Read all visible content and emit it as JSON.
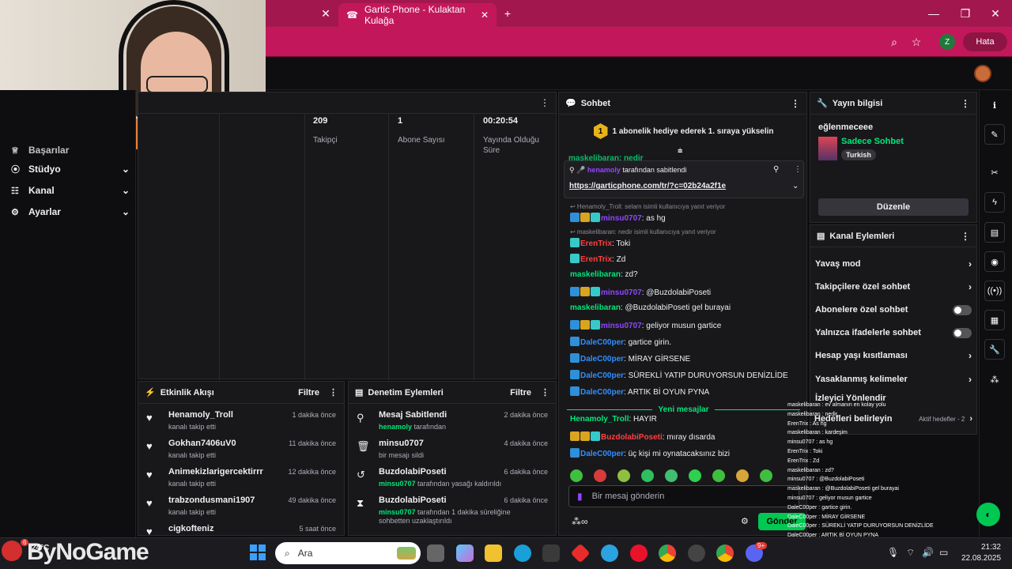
{
  "browser": {
    "tab_title": "Gartic Phone - Kulaktan Kulağa",
    "profile_initial": "Z",
    "status_button": "Hata"
  },
  "sidebar": {
    "items": [
      {
        "label": "Başarılar",
        "icon": "trophy-icon"
      },
      {
        "label": "Stüdyo",
        "icon": "camera-icon"
      },
      {
        "label": "Kanal",
        "icon": "people-icon"
      },
      {
        "label": "Ayarlar",
        "icon": "gear-icon"
      }
    ]
  },
  "stats": [
    {
      "value": "209",
      "label": "Takipçi"
    },
    {
      "value": "1",
      "label": "Abone Sayısı"
    },
    {
      "value": "00:20:54",
      "label": "Yayında Olduğu Süre"
    }
  ],
  "activity": {
    "title": "Etkinlik Akışı",
    "filter": "Filtre",
    "items": [
      {
        "name": "Henamoly_Troll",
        "sub": "kanalı takip etti",
        "time": "1 dakika önce"
      },
      {
        "name": "Gokhan7406uV0",
        "sub": "kanalı takip etti",
        "time": "11 dakika önce"
      },
      {
        "name": "Animekizlarigercektirrr",
        "sub": "kanalı takip etti",
        "time": "12 dakika önce"
      },
      {
        "name": "trabzondusmani1907",
        "sub": "kanalı takip etti",
        "time": "49 dakika önce"
      },
      {
        "name": "cigkofteniz",
        "sub": "",
        "time": "5 saat önce"
      }
    ]
  },
  "moderation": {
    "title": "Denetim Eylemleri",
    "filter": "Filtre",
    "items": [
      {
        "title": "Mesaj Sabitlendi",
        "user": "henamoly",
        "rest": " tarafından",
        "time": "2 dakika önce",
        "icon": "pin-icon"
      },
      {
        "title": "minsu0707",
        "user": "",
        "rest": "bir mesajı sildi",
        "time": "4 dakika önce",
        "icon": "trash-icon"
      },
      {
        "title": "BuzdolabiPoseti",
        "user": "minsu0707",
        "rest": " tarafından yasağı kaldırıldı",
        "time": "6 dakika önce",
        "icon": "undo-icon"
      },
      {
        "title": "BuzdolabiPoseti",
        "user": "minsu0707",
        "rest": " tarafından 1 dakika süreliğine sohbetten uzaklaştırıldı",
        "time": "6 dakika önce",
        "icon": "hourglass-icon"
      }
    ]
  },
  "chat": {
    "title": "Sohbet",
    "gift_banner": "1 abonelik hediye ederek 1. sıraya yükselin",
    "gift_rank": "1",
    "cut_line": "maskelibaran: nedir",
    "pinned_by_user": "henamoly",
    "pinned_by_rest": " tarafından sabitlendi",
    "pinned_link": "https://garticphone.com/tr/?c=02b24a2f1e",
    "new_messages": "Yeni mesajlar",
    "input_placeholder": "Bir mesaj gönderin",
    "send": "Gönder",
    "messages": [
      {
        "reply": "Henamoly_Troll: selam isimli kullanıcıya yanıt veriyor",
        "user": "minsu0707",
        "color": "#9146ff",
        "text": ": as hg",
        "badges": [
          "b-blue",
          "b-gold",
          "b-cyan"
        ]
      },
      {
        "reply": "maskelibaran: nedir isimli kullanıcıya yanıt veriyor",
        "user": "ErenTrix",
        "color": "#ff4040",
        "text": ": Toki",
        "badges": [
          "b-cyan"
        ]
      },
      {
        "reply": "",
        "user": "ErenTrix",
        "color": "#ff4040",
        "text": ": Zd",
        "badges": [
          "b-cyan"
        ]
      },
      {
        "reply": "",
        "user": "maskelibaran",
        "color": "#00e87a",
        "text": ": zd?",
        "badges": []
      },
      {
        "reply": "",
        "user": "minsu0707",
        "color": "#9146ff",
        "text": ": @BuzdolabiPoseti",
        "badges": [
          "b-blue",
          "b-gold",
          "b-cyan"
        ]
      },
      {
        "reply": "",
        "user": "maskelibaran",
        "color": "#00e87a",
        "text": ": @BuzdolabiPoseti gel burayai",
        "badges": []
      },
      {
        "reply": "",
        "user": "minsu0707",
        "color": "#9146ff",
        "text": ": geliyor musun gartice",
        "badges": [
          "b-blue",
          "b-gold",
          "b-cyan"
        ]
      },
      {
        "reply": "",
        "user": "DaleC00per",
        "color": "#2f8fff",
        "text": ": gartice girin.",
        "badges": [
          "b-blue"
        ]
      },
      {
        "reply": "",
        "user": "DaleC00per",
        "color": "#2f8fff",
        "text": ": MİRAY GİRSENE",
        "badges": [
          "b-blue"
        ]
      },
      {
        "reply": "",
        "user": "DaleC00per",
        "color": "#2f8fff",
        "text": ": SÜREKLİ YATIP DURUYORSUN DENİZLİDE",
        "badges": [
          "b-blue"
        ]
      },
      {
        "reply": "",
        "user": "DaleC00per",
        "color": "#2f8fff",
        "text": ": ARTIK Bİ OYUN PYNA",
        "badges": [
          "b-blue"
        ]
      }
    ],
    "new_msgs": [
      {
        "user": "Henamoly_Troll",
        "color": "#00e87a",
        "text": ": HAYIR",
        "badges": []
      },
      {
        "user": "BuzdolabiPoseti",
        "color": "#ff4040",
        "text": ": mıray dısarda",
        "badges": [
          "b-gold",
          "b-gold",
          "b-cyan"
        ]
      },
      {
        "user": "DaleC00per",
        "color": "#2f8fff",
        "text": ": üç kişi mi oynatacaksınız bizi",
        "badges": [
          "b-blue"
        ]
      }
    ]
  },
  "stream_info": {
    "title": "Yayın bilgisi",
    "stream_title": "eğlenmeceee",
    "category": "Sadece Sohbet",
    "tag": "Turkish",
    "edit": "Düzenle"
  },
  "channel_actions": {
    "title": "Kanal Eylemleri",
    "items": [
      {
        "label": "Yavaş mod",
        "control": "chevron"
      },
      {
        "label": "Takipçilere özel sohbet",
        "control": "chevron"
      },
      {
        "label": "Abonelere özel sohbet",
        "control": "toggle"
      },
      {
        "label": "Yalnızca ifadelerle sohbet",
        "control": "toggle"
      },
      {
        "label": "Hesap yaşı kısıtlaması",
        "control": "chevron"
      },
      {
        "label": "Yasaklanmış kelimeler",
        "control": "chevron"
      },
      {
        "label": "İzleyici Yönlendir",
        "control": ""
      },
      {
        "label": "Hedefleri belirleyin",
        "control": "chevron"
      }
    ],
    "goals_hint": "Aktif hedefler - 2"
  },
  "overlay_chat": [
    "maskelibaran : ev almanın en kolay yolu",
    "maskelibaran : nedir",
    "ErenTrix : As hg",
    "maskelibaran : kardeşim",
    "minsu0707 : as hg",
    "ErenTrix : Toki",
    "ErenTrix : Zd",
    "maskelibaran : zd?",
    "minsu0707 : @BuzdolabiPoseti",
    "maskelibaran : @BuzdolabiPoseti gel burayai",
    "minsu0707 : geliyor musun gartice",
    "DaleC00per : gartice girin.",
    "DaleC00per : MİRAY GİRSENE",
    "DaleC00per : SÜREKLİ YATIP DURUYORSUN DENİZLİDE",
    "DaleC00per : ARTIK Bİ OYUN PYNA",
    "Henamoly_Troll : HAYIR",
    "BuzdolabiPoseti : mıray dısarda",
    "DaleC00per : üç kişi mi oynatacaksınız bizi"
  ],
  "taskbar": {
    "search_placeholder": "Ara",
    "weather_temp": "24°C",
    "time": "21:32",
    "date": "22.08.2025",
    "watermark": "ByNoGame",
    "notif_count": "6",
    "discord_badge": "9+"
  }
}
